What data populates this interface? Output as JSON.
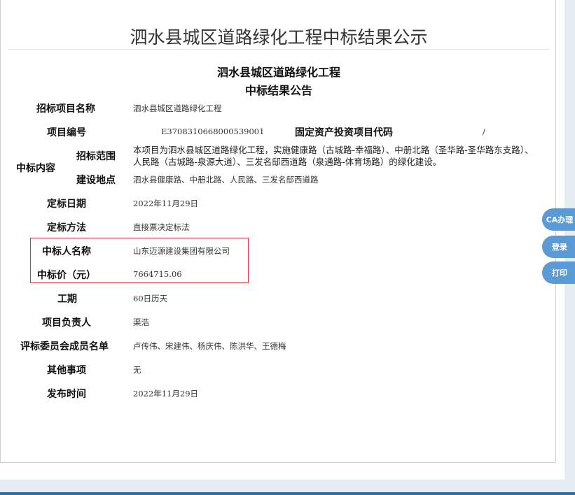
{
  "page_title": "泗水县城区道路绿化工程中标结果公示",
  "notice": {
    "heading_line1": "泗水县城区道路绿化工程",
    "heading_line2": "中标结果公告"
  },
  "fields": {
    "project_name_label": "招标项目名称",
    "project_name_value": "泗水县城区道路绿化工程",
    "project_code_label": "项目编号",
    "project_code_value": "E3708310668000539001",
    "fixed_asset_code_label": "固定资产投资项目代码",
    "fixed_asset_code_value": "/",
    "bid_content_label": "中标内容",
    "bid_scope_label": "招标范围",
    "bid_scope_value": "本项目为泗水县城区道路绿化工程，实施健康路（古城路-幸福路）、中册北路（圣华路-圣华路东支路）、人民路（古城路-泉源大道）、三发名邸西道路（泉通路-体育场路）的绿化建设。",
    "site_label": "建设地点",
    "site_value": "泗水县健康路、中册北路、人民路、三发名邸西道路",
    "decision_date_label": "定标日期",
    "decision_date_value": "2022年11月29日",
    "decision_method_label": "定标方法",
    "decision_method_value": "直接票决定标法",
    "winner_label": "中标人名称",
    "winner_value": "山东迈源建设集团有限公司",
    "price_label": "中标价（元）",
    "price_value": "7664715.06",
    "period_label": "工期",
    "period_value": "60日历天",
    "manager_label": "项目负责人",
    "manager_value": "渠浩",
    "committee_label": "评标委员会成员名单",
    "committee_value": "卢传伟、宋建伟、杨庆伟、陈洪华、王德梅",
    "other_label": "其他事项",
    "other_value": "无",
    "publish_label": "发布时间",
    "publish_value": "2022年11月29日"
  },
  "side_buttons": {
    "ca": "CA办理",
    "login": "登录",
    "print": "打印"
  },
  "colors": {
    "highlight_border": "#d9363e",
    "side_button": "#5b9bd5",
    "footer_bar": "#2f6ea5"
  }
}
